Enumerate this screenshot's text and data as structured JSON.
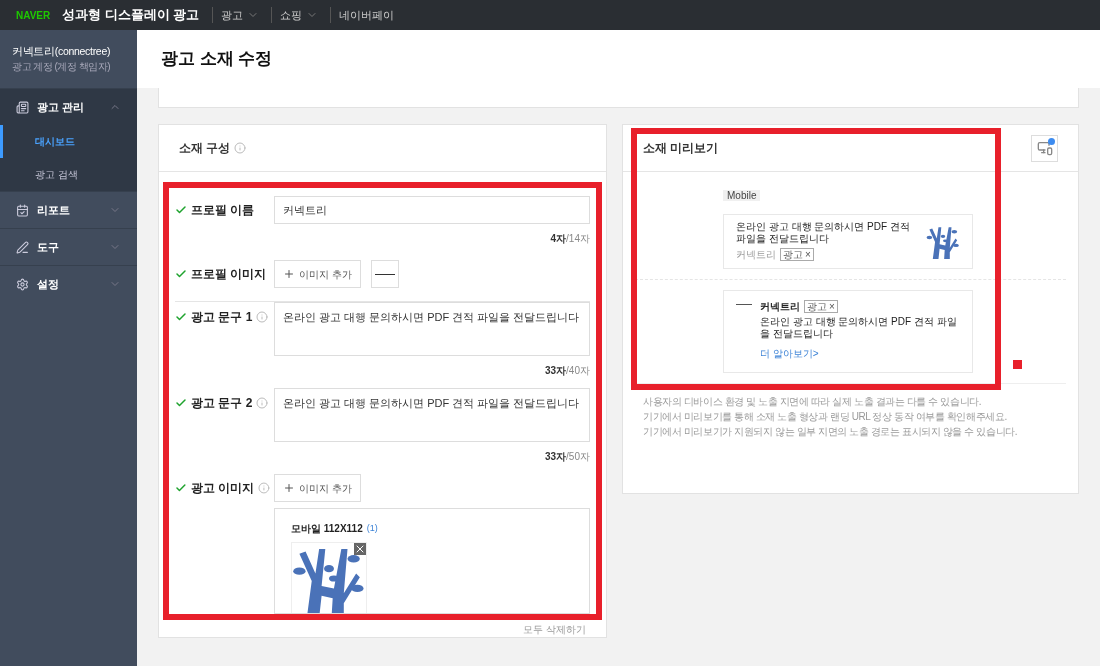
{
  "topbar": {
    "brand": "NAVER",
    "title": "성과형 디스플레이 광고",
    "menus": [
      {
        "label": "광고",
        "has_dropdown": true
      },
      {
        "label": "쇼핑",
        "has_dropdown": true
      },
      {
        "label": "네이버페이",
        "has_dropdown": false
      }
    ]
  },
  "sidebar": {
    "account": "커넥트리(connectree)",
    "role": "광고 계정 (계정 책임자)",
    "items": [
      {
        "label": "광고 관리",
        "expanded": true,
        "children": [
          {
            "label": "대시보드",
            "selected": true
          },
          {
            "label": "광고 검색",
            "selected": false
          }
        ]
      },
      {
        "label": "리포트",
        "expanded": false
      },
      {
        "label": "도구",
        "expanded": false
      },
      {
        "label": "설정",
        "expanded": false
      }
    ]
  },
  "page_title": "광고 소재 수정",
  "composition": {
    "title": "소재 구성",
    "fields": [
      {
        "kind": "text",
        "label": "프로필 이름",
        "valid": true,
        "info": false,
        "value": "커넥트리",
        "count": "**4자**/14자"
      },
      {
        "kind": "image",
        "label": "프로필 이미지",
        "valid": true,
        "info": false,
        "button": "이미지 추가"
      },
      {
        "kind": "textarea",
        "label": "광고 문구 1",
        "valid": true,
        "info": true,
        "value": "온라인 광고 대행 문의하시면 PDF 견적 파일을 전달드립니다",
        "count": "**33자**/40자"
      },
      {
        "kind": "textarea",
        "label": "광고 문구 2",
        "valid": true,
        "info": true,
        "value": "온라인 광고 대행 문의하시면 PDF 견적 파일을 전달드립니다",
        "count": "**33자**/50자"
      },
      {
        "kind": "ad_image",
        "label": "광고 이미지",
        "valid": true,
        "info": true,
        "button": "이미지 추가",
        "group": "모바일 112X112",
        "group_count": "(1)"
      }
    ],
    "delete_all": "모두 삭제하기"
  },
  "preview": {
    "title": "소재 미리보기",
    "badge": "Mobile",
    "ad1": {
      "text": "온라인 광고 대행 문의하시면 PDF 견적 파일을 전달드립니다",
      "advertiser": "커넥트리",
      "tag": "광고",
      "close": "×"
    },
    "ad2": {
      "name": "커넥트리",
      "tag": "광고",
      "close": "×",
      "text": "온라인 광고 대행 문의하시면 PDF 견적 파일을 전달드립니다",
      "link": "더 알아보기>"
    },
    "notes": [
      "사용자의 디바이스 환경 및 노출 지면에 따라 실제 노출 결과는 다를 수 있습니다.",
      "기기에서 미리보기를 통해 소재 노출 형상과 랜딩 URL 정상 동작 여부를 확인해주세요.",
      "기기에서 미리보기가 지원되지 않는 일부 지면의 노출 경로는 표시되지 않을 수 있습니다."
    ]
  }
}
